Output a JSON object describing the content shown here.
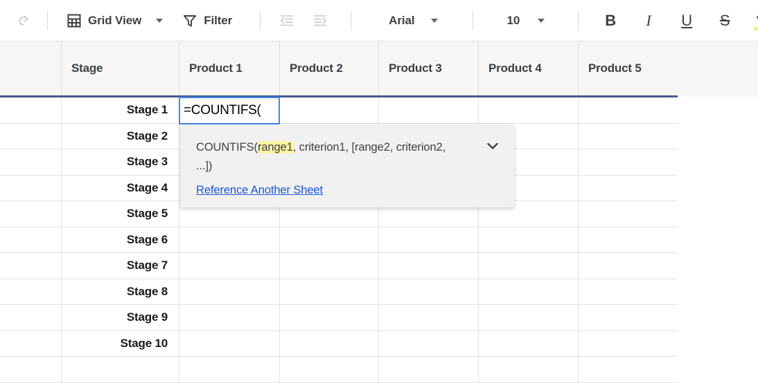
{
  "toolbar": {
    "redo_icon": "redo-icon",
    "grid_view": {
      "label": "Grid View",
      "icon": "table-grid-icon",
      "caret": "chevron-down-icon"
    },
    "filter": {
      "label": "Filter",
      "icon": "funnel-filter-icon"
    },
    "outdent_icon": "decrease-indent-icon",
    "indent_icon": "increase-indent-icon",
    "font": {
      "value": "Arial",
      "caret": "chevron-down-icon"
    },
    "font_size": {
      "value": "10",
      "caret": "chevron-down-icon"
    },
    "bold": "B",
    "italic": "I",
    "underline": "U",
    "strikethrough": "S",
    "fill_color": {
      "icon": "fill-color-icon",
      "swatch": "#fbf06f"
    }
  },
  "gutter": {
    "icons": [
      "comment-icon",
      "attachment-icon",
      "info-icon"
    ]
  },
  "grid": {
    "columns": [
      "Stage",
      "Product 1",
      "Product 2",
      "Product 3",
      "Product 4",
      "Product 5"
    ],
    "rows": [
      "Stage 1",
      "Stage 2",
      "Stage 3",
      "Stage 4",
      "Stage 5",
      "Stage 6",
      "Stage 7",
      "Stage 8",
      "Stage 9",
      "Stage 10",
      ""
    ],
    "header_underline_color": "#45598d",
    "selection_color": "#4285f4"
  },
  "active_cell": {
    "value": "=COUNTIFS(",
    "column": "Product 1",
    "row": "Stage 1"
  },
  "formula_tooltip": {
    "name": "COUNTIFS(",
    "arg_highlighted": "range1",
    "args_rest": ", criterion1, [range2, criterion2, ...])",
    "link": "Reference Another Sheet",
    "collapse_icon": "chevron-down-icon",
    "highlight_color": "#fdf4a3"
  }
}
